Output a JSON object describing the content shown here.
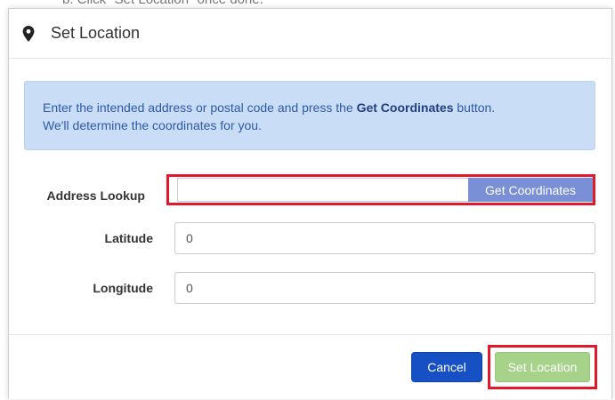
{
  "backdrop": {
    "partial_text": "b.  Click \"Set Location\" once done."
  },
  "modal": {
    "title": "Set Location",
    "icon": "map-marker-icon",
    "info": {
      "line1_before": "Enter the intended address or postal code and press the ",
      "line1_bold": "Get Coordinates",
      "line1_after": " button.",
      "line2": "We'll determine the coordinates for you."
    },
    "form": {
      "address_label": "Address Lookup",
      "address_value": "",
      "get_coordinates_label": "Get Coordinates",
      "latitude_label": "Latitude",
      "latitude_value": "0",
      "longitude_label": "Longitude",
      "longitude_value": "0"
    },
    "footer": {
      "cancel_label": "Cancel",
      "set_location_label": "Set Location"
    }
  },
  "colors": {
    "info_bg": "#c9ddf7",
    "get_coordinates_bg": "#7a90d6",
    "cancel_bg": "#1650c4",
    "set_location_bg": "#a6d28a",
    "highlight": "#e1192a"
  }
}
